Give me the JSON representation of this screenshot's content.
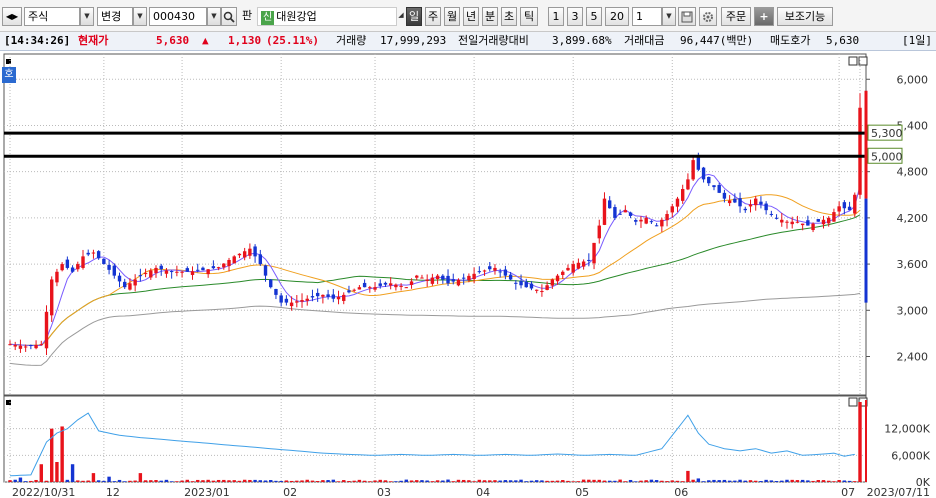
{
  "toolbar": {
    "market_type": "주식",
    "change_label": "변경",
    "code": "000430",
    "pan_label": "판",
    "badge": "신",
    "company": "대원강업",
    "periods": [
      "일",
      "주",
      "월",
      "년",
      "분",
      "초",
      "틱"
    ],
    "active_period": "일",
    "intervals": [
      "1",
      "3",
      "5",
      "20"
    ],
    "count_value": "1",
    "order_label": "주문",
    "aux_label": "보조기능"
  },
  "info": {
    "time": "[14:34:26]",
    "price_label": "현재가",
    "price": "5,630",
    "arrow": "▲",
    "change": "1,130",
    "change_pct": "(25.11%)",
    "volume_label": "거래량",
    "volume": "17,999,293",
    "prev_volume_label": "전일거래량대비",
    "prev_volume_ratio": "3,899.68%",
    "amount_label": "거래대금",
    "amount": "96,447(백만)",
    "ask_label": "매도호가",
    "ask": "5,630",
    "period_count": "[1일]"
  },
  "side_label": "호",
  "chart_data": {
    "type": "candlestick",
    "price_axis": {
      "ticks": [
        2400,
        3000,
        3600,
        4200,
        4800,
        5400,
        6000
      ],
      "labels": [
        "2,400",
        "3,000",
        "3,600",
        "4,200",
        "4,800",
        "5,400",
        "6,000"
      ],
      "range": [
        1900,
        6250
      ]
    },
    "horizontal_lines": [
      {
        "value": 5300,
        "label": "5,300"
      },
      {
        "value": 5000,
        "label": "5,000"
      }
    ],
    "volume_axis": {
      "ticks": [
        0,
        6000,
        12000
      ],
      "labels": [
        "0K",
        "6,000K",
        "12,000K"
      ],
      "range": [
        0,
        18000
      ]
    },
    "x_labels": [
      "2022/10/31",
      "12",
      "2023/01",
      "02",
      "03",
      "04",
      "05",
      "06",
      "07",
      "2023/07/11"
    ],
    "current_price": 5630,
    "current_volume_k": 17999,
    "colors": {
      "up": "#e8131b",
      "down": "#1434d2",
      "ma5": "#7a5cff",
      "ma20": "#f0a020",
      "ma60": "#2a8a2a",
      "ma120": "#9a9a9a",
      "volume_line": "#3fa0e8"
    },
    "price_path": [
      [
        0,
        2560
      ],
      [
        3,
        2530
      ],
      [
        6,
        2560
      ],
      [
        8,
        3400
      ],
      [
        10,
        3600
      ],
      [
        12,
        3500
      ],
      [
        14,
        3700
      ],
      [
        16,
        3750
      ],
      [
        18,
        3600
      ],
      [
        20,
        3450
      ],
      [
        22,
        3300
      ],
      [
        25,
        3450
      ],
      [
        28,
        3550
      ],
      [
        31,
        3500
      ],
      [
        34,
        3500
      ],
      [
        37,
        3520
      ],
      [
        40,
        3560
      ],
      [
        43,
        3700
      ],
      [
        46,
        3800
      ],
      [
        48,
        3600
      ],
      [
        50,
        3300
      ],
      [
        52,
        3100
      ],
      [
        54,
        3100
      ],
      [
        57,
        3150
      ],
      [
        60,
        3200
      ],
      [
        62,
        3150
      ],
      [
        64,
        3200
      ],
      [
        67,
        3300
      ],
      [
        70,
        3300
      ],
      [
        73,
        3350
      ],
      [
        76,
        3300
      ],
      [
        78,
        3450
      ],
      [
        80,
        3400
      ],
      [
        82,
        3450
      ],
      [
        84,
        3350
      ],
      [
        87,
        3420
      ],
      [
        90,
        3500
      ],
      [
        93,
        3550
      ],
      [
        95,
        3450
      ],
      [
        97,
        3350
      ],
      [
        99,
        3300
      ],
      [
        102,
        3250
      ],
      [
        104,
        3400
      ],
      [
        106,
        3500
      ],
      [
        108,
        3600
      ],
      [
        111,
        3650
      ],
      [
        113,
        4100
      ],
      [
        114,
        4450
      ],
      [
        116,
        4200
      ],
      [
        118,
        4300
      ],
      [
        120,
        4150
      ],
      [
        122,
        4200
      ],
      [
        124,
        4100
      ],
      [
        126,
        4250
      ],
      [
        128,
        4450
      ],
      [
        130,
        4700
      ],
      [
        131,
        4950
      ],
      [
        133,
        4700
      ],
      [
        135,
        4600
      ],
      [
        137,
        4450
      ],
      [
        139,
        4400
      ],
      [
        141,
        4300
      ],
      [
        143,
        4450
      ],
      [
        145,
        4300
      ],
      [
        147,
        4200
      ],
      [
        149,
        4150
      ],
      [
        151,
        4150
      ],
      [
        153,
        4100
      ],
      [
        155,
        4150
      ],
      [
        157,
        4200
      ],
      [
        159,
        4350
      ],
      [
        161,
        4300
      ],
      [
        162,
        4500
      ],
      [
        163,
        5630
      ]
    ],
    "volume_path_k": [
      [
        0,
        1400
      ],
      [
        4,
        1600
      ],
      [
        7,
        9000
      ],
      [
        9,
        11000
      ],
      [
        11,
        12000
      ],
      [
        13,
        14000
      ],
      [
        15,
        15500
      ],
      [
        17,
        11500
      ],
      [
        19,
        11000
      ],
      [
        21,
        10500
      ],
      [
        25,
        10000
      ],
      [
        30,
        9500
      ],
      [
        35,
        9000
      ],
      [
        40,
        8500
      ],
      [
        45,
        8000
      ],
      [
        50,
        7500
      ],
      [
        55,
        7000
      ],
      [
        60,
        6500
      ],
      [
        65,
        6200
      ],
      [
        70,
        6000
      ],
      [
        75,
        6200
      ],
      [
        80,
        6000
      ],
      [
        85,
        6200
      ],
      [
        90,
        6000
      ],
      [
        95,
        6200
      ],
      [
        100,
        6000
      ],
      [
        105,
        6300
      ],
      [
        110,
        6000
      ],
      [
        115,
        6200
      ],
      [
        120,
        6000
      ],
      [
        125,
        7500
      ],
      [
        128,
        12000
      ],
      [
        130,
        15000
      ],
      [
        132,
        11000
      ],
      [
        134,
        8500
      ],
      [
        137,
        7500
      ],
      [
        140,
        7000
      ],
      [
        143,
        7500
      ],
      [
        146,
        6500
      ],
      [
        149,
        7000
      ],
      [
        152,
        6000
      ],
      [
        155,
        6200
      ],
      [
        158,
        6500
      ],
      [
        160,
        5800
      ],
      [
        162,
        6200
      ]
    ],
    "volume_spikes_k": [
      [
        2,
        1000
      ],
      [
        6,
        4000
      ],
      [
        8,
        12000
      ],
      [
        9,
        4500
      ],
      [
        10,
        12500
      ],
      [
        12,
        4000
      ],
      [
        16,
        2000
      ],
      [
        19,
        1200
      ],
      [
        25,
        2000
      ],
      [
        130,
        2500
      ],
      [
        132,
        800
      ],
      [
        163,
        17999
      ]
    ]
  }
}
